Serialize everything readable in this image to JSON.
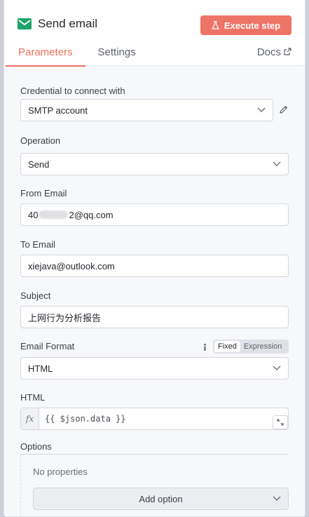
{
  "header": {
    "node_title": "Send email",
    "node_icon": "envelope-icon",
    "execute_label": "Execute step",
    "execute_color": "#ef7468"
  },
  "tabs": [
    {
      "label": "Parameters",
      "active": true
    },
    {
      "label": "Settings",
      "active": false
    }
  ],
  "docs_label": "Docs",
  "accent": "#ee6f5e",
  "fields": {
    "credential": {
      "label": "Credential to connect with",
      "value": "SMTP account"
    },
    "operation": {
      "label": "Operation",
      "value": "Send"
    },
    "from_email": {
      "label": "From Email",
      "value_prefix": "40",
      "value_suffix": "2@qq.com"
    },
    "to_email": {
      "label": "To Email",
      "value": "xiejava@outlook.com"
    },
    "subject": {
      "label": "Subject",
      "value": "上网行为分析报告"
    },
    "email_format": {
      "label": "Email Format",
      "value": "HTML",
      "mode_options": [
        "Fixed",
        "Expression"
      ],
      "mode_selected": "Fixed"
    },
    "html": {
      "label": "HTML",
      "fx_label": "fx",
      "value": "{{ $json.data }}"
    }
  },
  "options": {
    "label": "Options",
    "empty_text": "No properties",
    "add_label": "Add option"
  }
}
